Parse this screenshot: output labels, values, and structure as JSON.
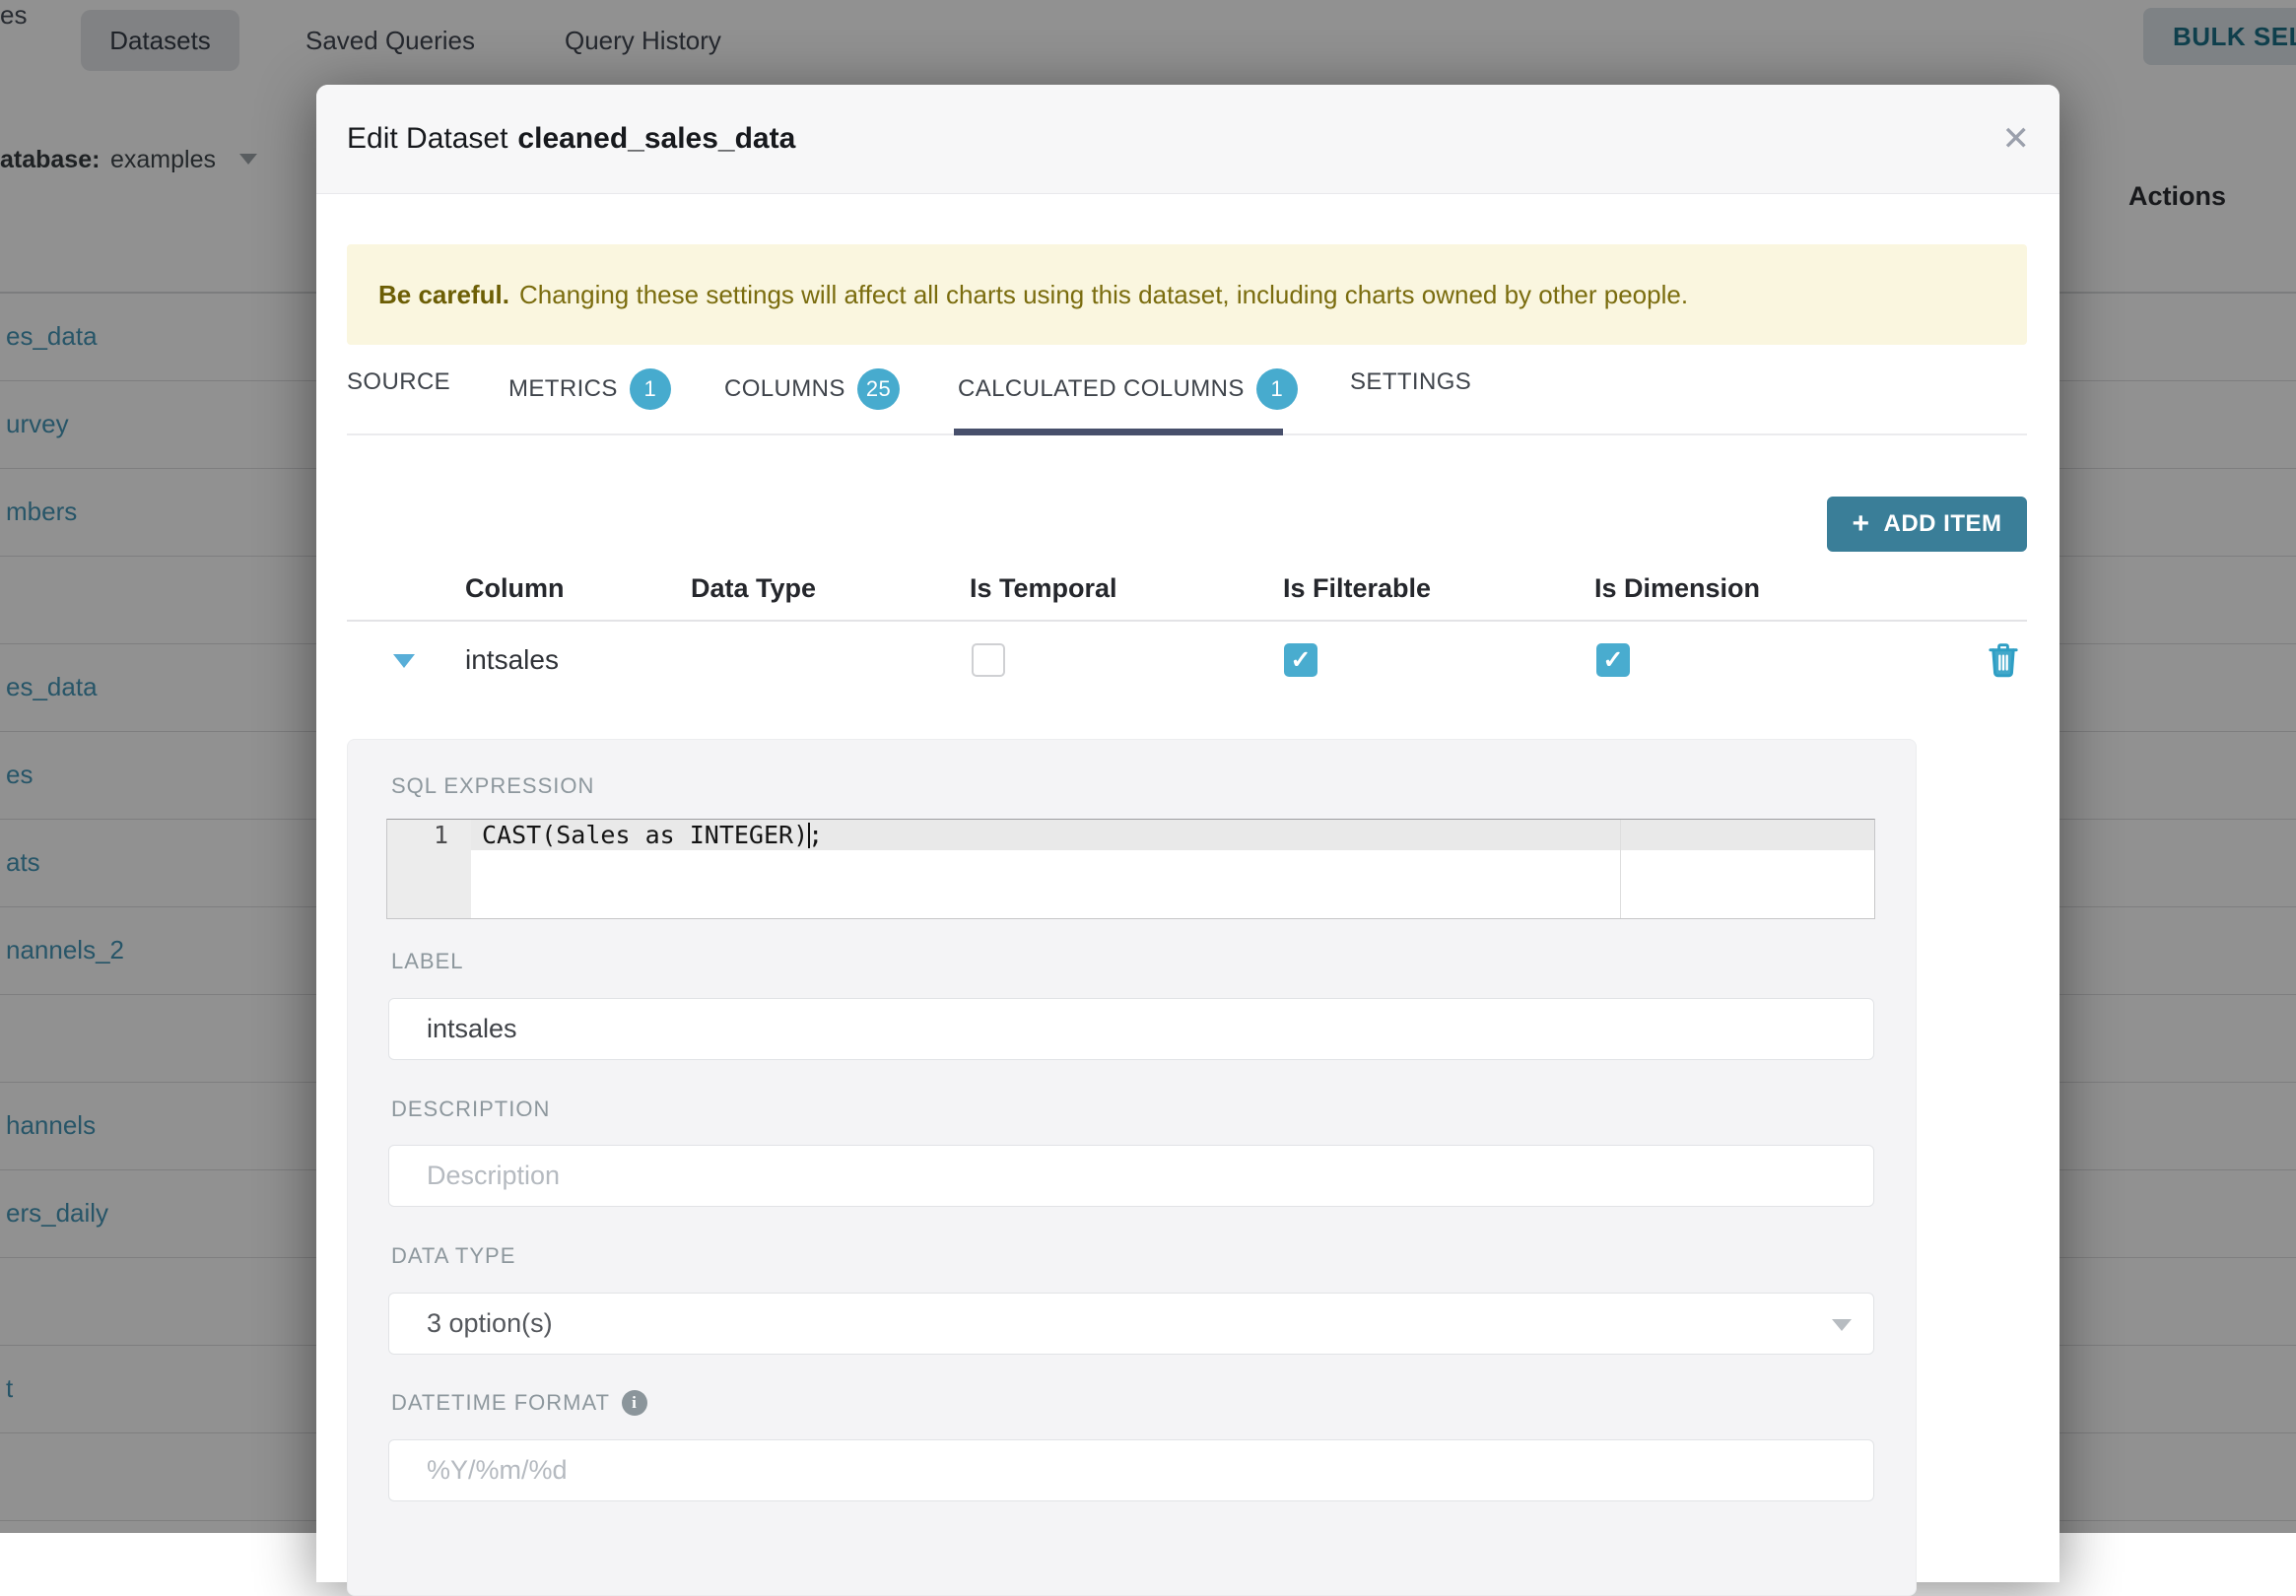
{
  "background": {
    "nav": {
      "clipped_item": "es",
      "active_tab": "Datasets",
      "tab_saved_queries": "Saved Queries",
      "tab_query_history": "Query History",
      "bulk_select_label": "BULK SELECT"
    },
    "filter": {
      "label": "atabase:",
      "value": "examples"
    },
    "table": {
      "actions_header": "Actions",
      "rows": [
        "es_data",
        "urvey",
        "mbers",
        "",
        "es_data",
        "es",
        "ats",
        "nannels_2",
        "",
        "hannels",
        "ers_daily",
        "",
        "t",
        ""
      ]
    }
  },
  "modal": {
    "title_prefix": "Edit Dataset",
    "dataset_name": "cleaned_sales_data",
    "warning": {
      "bold": "Be careful.",
      "text": "Changing these settings will affect all charts using this dataset, including charts owned by other people."
    },
    "tabs": [
      {
        "label": "SOURCE"
      },
      {
        "label": "METRICS",
        "badge": "1"
      },
      {
        "label": "COLUMNS",
        "badge": "25"
      },
      {
        "label": "CALCULATED COLUMNS",
        "badge": "1",
        "active": true
      },
      {
        "label": "SETTINGS"
      }
    ],
    "add_item": {
      "icon": "+",
      "label": "ADD ITEM"
    },
    "grid": {
      "headers": [
        "Column",
        "Data Type",
        "Is Temporal",
        "Is Filterable",
        "Is Dimension"
      ],
      "row": {
        "column": "intsales",
        "is_temporal": false,
        "is_filterable": true,
        "is_dimension": true
      }
    },
    "form": {
      "sql_label": "SQL EXPRESSION",
      "sql_line_number": "1",
      "sql_code": "CAST(Sales as INTEGER);",
      "label_label": "LABEL",
      "label_value": "intsales",
      "description_label": "DESCRIPTION",
      "description_placeholder": "Description",
      "datatype_label": "DATA TYPE",
      "datatype_value": "3 option(s)",
      "datetime_label": "DATETIME FORMAT",
      "datetime_placeholder": "%Y/%m/%d"
    }
  },
  "icons": {
    "close": "✕",
    "check": "✓",
    "info": "i"
  },
  "colors": {
    "accent_teal": "#47abce",
    "button_teal": "#3a7e98",
    "active_tab_underline": "#474f6b",
    "warning_bg": "#faf6df",
    "warning_text": "#7a6c0e",
    "link_teal": "#3e93b4"
  }
}
